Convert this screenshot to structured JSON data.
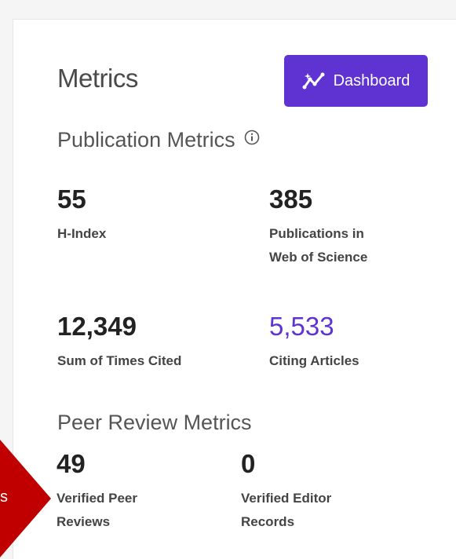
{
  "panel": {
    "title": "Metrics",
    "dashboard_button": {
      "label": "Dashboard",
      "icon": "trend-chart-icon",
      "color": "#5e33d1"
    }
  },
  "publication_metrics": {
    "title": "Publication Metrics",
    "info_icon": "info-icon",
    "items": [
      {
        "value": "55",
        "label": "H-Index"
      },
      {
        "value": "385",
        "label": "Publications in Web of Science"
      },
      {
        "value": "12,349",
        "label": "Sum of Times Cited"
      },
      {
        "value": "5,533",
        "label": "Citing Articles",
        "accent_color": "#5e33d1"
      }
    ]
  },
  "peer_review_metrics": {
    "title": "Peer Review Metrics",
    "items": [
      {
        "value": "49",
        "label": "Verified Peer Reviews"
      },
      {
        "value": "0",
        "label": "Verified Editor Records"
      }
    ]
  },
  "callout": {
    "text": "s",
    "color": "#c00000"
  }
}
